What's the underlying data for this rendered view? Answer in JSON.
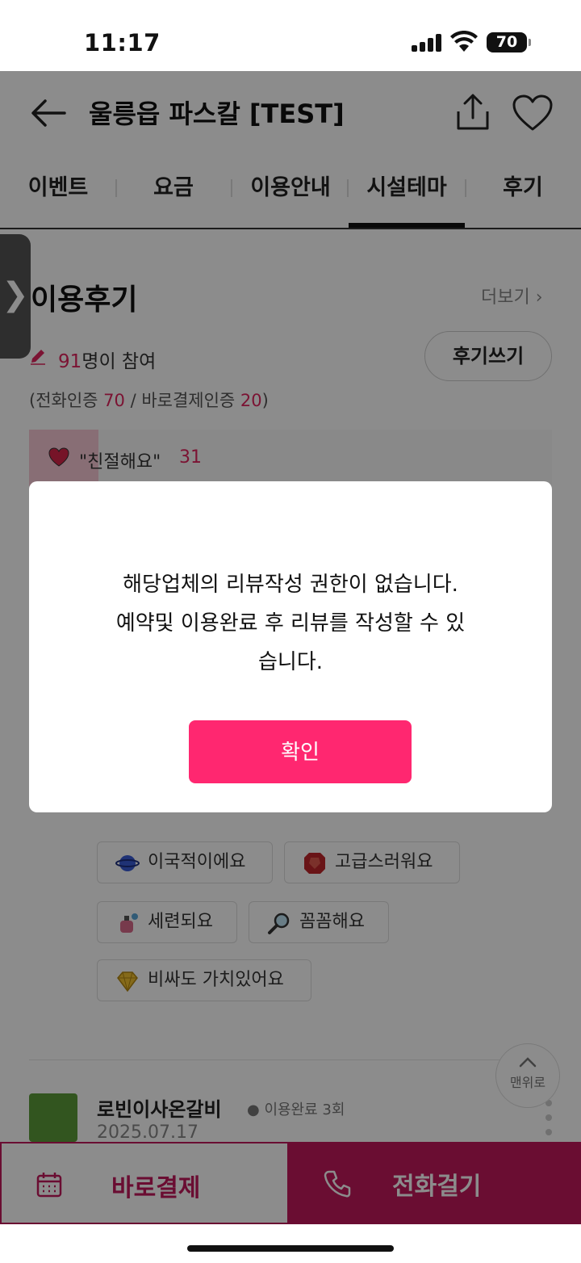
{
  "status_bar": {
    "time": "11:17",
    "battery": "70"
  },
  "header": {
    "title": "울릉읍 파스칼 [TEST]"
  },
  "tabs": [
    {
      "label": "이벤트"
    },
    {
      "label": "요금"
    },
    {
      "label": "이용안내"
    },
    {
      "label": "시설테마",
      "active": true
    },
    {
      "label": "후기"
    }
  ],
  "reviews": {
    "title": "이용후기",
    "more": "더보기",
    "participants_count": "91",
    "participants_suffix": "명이 참여",
    "write_button": "후기쓰기",
    "verify": {
      "prefix": "(전화인증 ",
      "phone_count": "70",
      "mid": " / 바로결제인증 ",
      "pay_count": "20",
      "suffix": ")"
    },
    "top_stat": {
      "label": "\"친절해요\"",
      "count": "31"
    },
    "chips": [
      {
        "label": "이국적이에요",
        "icon": "planet-icon"
      },
      {
        "label": "고급스러워요",
        "icon": "ruby-icon"
      },
      {
        "label": "세련되요",
        "icon": "perfume-icon"
      },
      {
        "label": "꼼꼼해요",
        "icon": "magnifier-icon"
      },
      {
        "label": "비싸도 가치있어요",
        "icon": "diamond-icon"
      }
    ],
    "first_review": {
      "name": "로빈이사온갈비",
      "badge": "이용완료 3회",
      "date": "2025.07.17"
    },
    "to_top": "맨위로"
  },
  "bottom_bar": {
    "pay_label": "바로결제",
    "call_label": "전화걸기"
  },
  "modal": {
    "message_line1": "해당업체의 리뷰작성 권한이 없습니다.",
    "message_line2": "예약및 이용완료 후 리뷰를 작성할 수 있",
    "message_line3": "습니다.",
    "confirm": "확인"
  },
  "colors": {
    "accent": "#ff2770",
    "brand": "#c2185b",
    "highlight": "#e0245e"
  }
}
